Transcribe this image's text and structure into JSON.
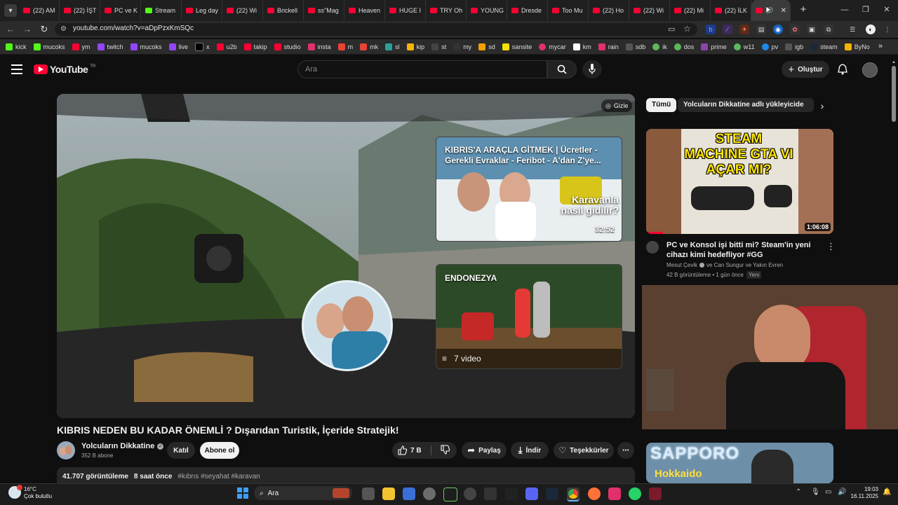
{
  "browser": {
    "tabs": [
      {
        "label": "(22) AM"
      },
      {
        "label": "(22) İŞT"
      },
      {
        "label": "PC ve K"
      },
      {
        "label": "Stream"
      },
      {
        "label": "Leg day"
      },
      {
        "label": "(22) Wi"
      },
      {
        "label": "Brickell"
      },
      {
        "label": "ss\"Mag"
      },
      {
        "label": "Heaven"
      },
      {
        "label": "HUGE I"
      },
      {
        "label": "TRY Oh"
      },
      {
        "label": "YOUNG"
      },
      {
        "label": "Dresde"
      },
      {
        "label": "Too Mu"
      },
      {
        "label": "(22) Ho"
      },
      {
        "label": "(22) Wi"
      },
      {
        "label": "(22) Mi"
      },
      {
        "label": "(22) İLK"
      }
    ],
    "url": "youtube.com/watch?v=aDpPzxKmSQc",
    "bookmarks": [
      "kick",
      "mucoks",
      "ym",
      "twitch",
      "mucoks",
      "live",
      "x",
      "u2b",
      "takip",
      "studio",
      "insta",
      "m",
      "mk",
      "sl",
      "kip",
      "st",
      "my",
      "sd",
      "sansite",
      "mycar",
      "km",
      "rain",
      "sdb",
      "ik",
      "dos",
      "prime",
      "w11",
      "pv",
      "igb",
      "steam",
      "ByNo"
    ]
  },
  "yt": {
    "logo_text": "YouTube",
    "logo_region": "TR",
    "search_placeholder": "Ara",
    "create_label": "Oluştur"
  },
  "player": {
    "hide_label": "Gizle",
    "endcard1": {
      "title": "KIBRIS'A ARAÇLA GİTMEK | Ücretler - Gerekli Evraklar - Feribot - A'dan Z'ye...",
      "overlay": "Karavanla nasıl gidilir?",
      "duration": "32:52"
    },
    "endcard2": {
      "title": "ENDONEZYA",
      "video_count": "7 video"
    }
  },
  "video": {
    "title": "KIBRIS NEDEN BU KADAR ÖNEMLİ ? Dışarıdan Turistik, İçeride Stratejik!",
    "channel": "Yolcuların Dikkatine",
    "subscribers": "352 B abone",
    "join_label": "Katıl",
    "subscribe_label": "Abone ol",
    "likes": "7 B",
    "share_label": "Paylaş",
    "download_label": "İndir",
    "thanks_label": "Teşekkürler",
    "views": "41.707 görüntüleme",
    "age": "8 saat önce",
    "hashtags": "#kıbrıs #seyahat #karavan"
  },
  "sidebar": {
    "chips": [
      "Tümü",
      "Yolcuların Dikkatine adlı yükleyiciden"
    ],
    "rec1": {
      "thumb_text": "STEAM MACHINE GTA VI AÇAR MI?",
      "duration": "1:06:08",
      "title": "PC ve Konsol işi bitti mi? Steam'in yeni cihazı kimi hedefliyor #GG",
      "channel": "Mesut Çevik",
      "with": "ve Can Sungur ve Yakın Evren",
      "meta": "42 B görüntüleme • 1 gün önce",
      "badge": "Yeni"
    },
    "rec3_thumb_text": "SAPPORO",
    "rec3_thumb_sub": "Hokkaido"
  },
  "taskbar": {
    "weather_temp": "16°C",
    "weather_desc": "Çok bulutlu",
    "search_label": "Ara",
    "time": "19:03",
    "date": "16.11.2025"
  }
}
